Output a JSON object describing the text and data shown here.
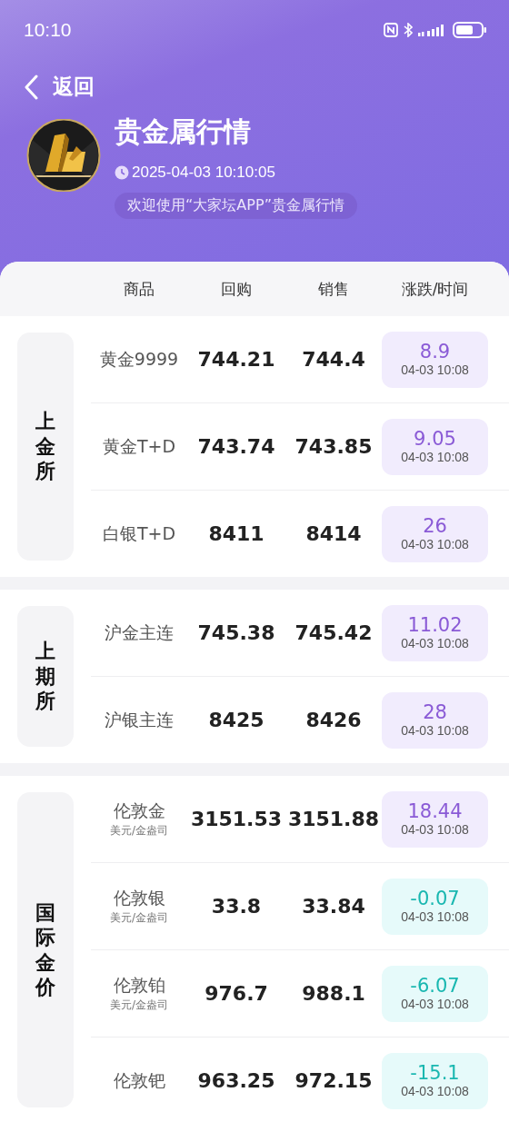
{
  "status_bar": {
    "time": "10:10"
  },
  "nav": {
    "back_label": "返回"
  },
  "header": {
    "title": "贵金属行情",
    "timestamp": "2025-04-03 10:10:05",
    "welcome": "欢迎使用“大家坛APP”贵金属行情"
  },
  "table": {
    "columns": [
      "商品",
      "回购",
      "销售",
      "涨跌/时间"
    ],
    "sections": [
      {
        "label": "上金所",
        "rows": [
          {
            "name": "黄金9999",
            "buy": "744.21",
            "sell": "744.4",
            "change": "8.9",
            "time": "04-03 10:08",
            "kind": "up"
          },
          {
            "name": "黄金T+D",
            "buy": "743.74",
            "sell": "743.85",
            "change": "9.05",
            "time": "04-03 10:08",
            "kind": "up"
          },
          {
            "name": "白银T+D",
            "buy": "8411",
            "sell": "8414",
            "change": "26",
            "time": "04-03 10:08",
            "kind": "up"
          }
        ]
      },
      {
        "label": "上期所",
        "rows": [
          {
            "name": "沪金主连",
            "buy": "745.38",
            "sell": "745.42",
            "change": "11.02",
            "time": "04-03 10:08",
            "kind": "up"
          },
          {
            "name": "沪银主连",
            "buy": "8425",
            "sell": "8426",
            "change": "28",
            "time": "04-03 10:08",
            "kind": "up"
          }
        ]
      },
      {
        "label": "国际金价",
        "rows": [
          {
            "name": "伦敦金",
            "unit": "美元/金盎司",
            "buy": "3151.53",
            "sell": "3151.88",
            "change": "18.44",
            "time": "04-03 10:08",
            "kind": "up"
          },
          {
            "name": "伦敦银",
            "unit": "美元/金盎司",
            "buy": "33.8",
            "sell": "33.84",
            "change": "-0.07",
            "time": "04-03 10:08",
            "kind": "down"
          },
          {
            "name": "伦敦铂",
            "unit": "美元/金盎司",
            "buy": "976.7",
            "sell": "988.1",
            "change": "-6.07",
            "time": "04-03 10:08",
            "kind": "down"
          },
          {
            "name": "伦敦钯",
            "buy": "963.25",
            "sell": "972.15",
            "change": "-15.1",
            "time": "04-03 10:08",
            "kind": "down"
          }
        ]
      }
    ]
  }
}
